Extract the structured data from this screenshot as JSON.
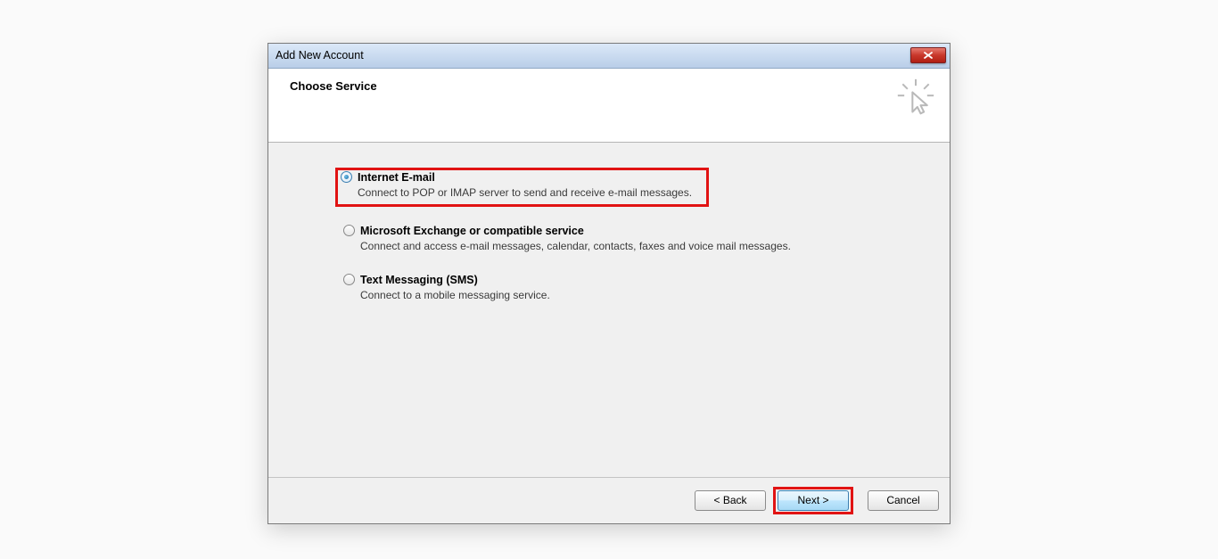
{
  "window": {
    "title": "Add New Account"
  },
  "header": {
    "heading": "Choose Service"
  },
  "options": {
    "0": {
      "label": "Internet E-mail",
      "desc": "Connect to POP or IMAP server to send and receive e-mail messages."
    },
    "1": {
      "label": "Microsoft Exchange or compatible service",
      "desc": "Connect and access e-mail messages, calendar, contacts, faxes and voice mail messages."
    },
    "2": {
      "label": "Text Messaging (SMS)",
      "desc": "Connect to a mobile messaging service."
    }
  },
  "buttons": {
    "back": "< Back",
    "next": "Next >",
    "cancel": "Cancel"
  }
}
